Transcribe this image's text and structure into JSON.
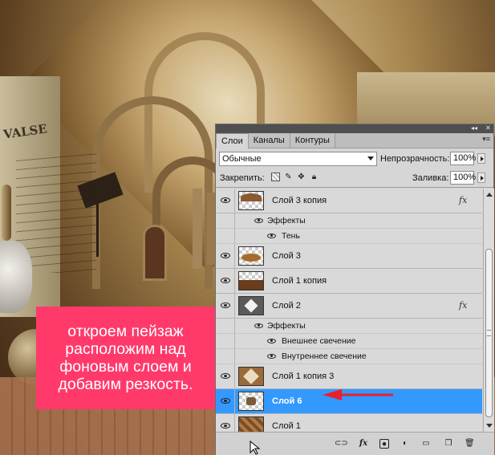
{
  "caption": {
    "text": "откроем пейзаж\nрасположим над\nфоновым слоем и\nдобавим резкость."
  },
  "panel": {
    "tabs": [
      {
        "label": "Слои",
        "active": true
      },
      {
        "label": "Каналы",
        "active": false
      },
      {
        "label": "Контуры",
        "active": false
      }
    ],
    "blend_mode": "Обычные",
    "opacity_label": "Непрозрачность:",
    "opacity_value": "100%",
    "lock_label": "Закрепить:",
    "fill_label": "Заливка:",
    "fill_value": "100%",
    "layers": [
      {
        "name": "Слой 3 копия",
        "fx": "fx",
        "selected": false
      },
      {
        "effects_label": "Эффекты"
      },
      {
        "effect": "Тень"
      },
      {
        "name": "Слой 3",
        "selected": false
      },
      {
        "name": "Слой 1 копия",
        "selected": false
      },
      {
        "name": "Слой 2",
        "fx": "fx",
        "selected": false
      },
      {
        "effects_label": "Эффекты"
      },
      {
        "effect": "Внешнее свечение"
      },
      {
        "effect": "Внутреннее свечение"
      },
      {
        "name": "Слой 1 копия 3",
        "selected": false
      },
      {
        "name": "Слой 6",
        "selected": true
      },
      {
        "name": "Слой 1",
        "selected": false
      }
    ],
    "bottom_icons": [
      "link-icon",
      "fx-icon",
      "mask-icon",
      "adjustment-icon",
      "group-icon",
      "new-layer-icon",
      "trash-icon"
    ],
    "bottom_fx_label": "fx",
    "colors": {
      "selected": "#3399ff",
      "caption_bg": "#ff3a6b",
      "arrow": "#e8202a"
    }
  },
  "background": {
    "sign_text": "VALSE",
    "sign_sub": "Ⅰ"
  }
}
